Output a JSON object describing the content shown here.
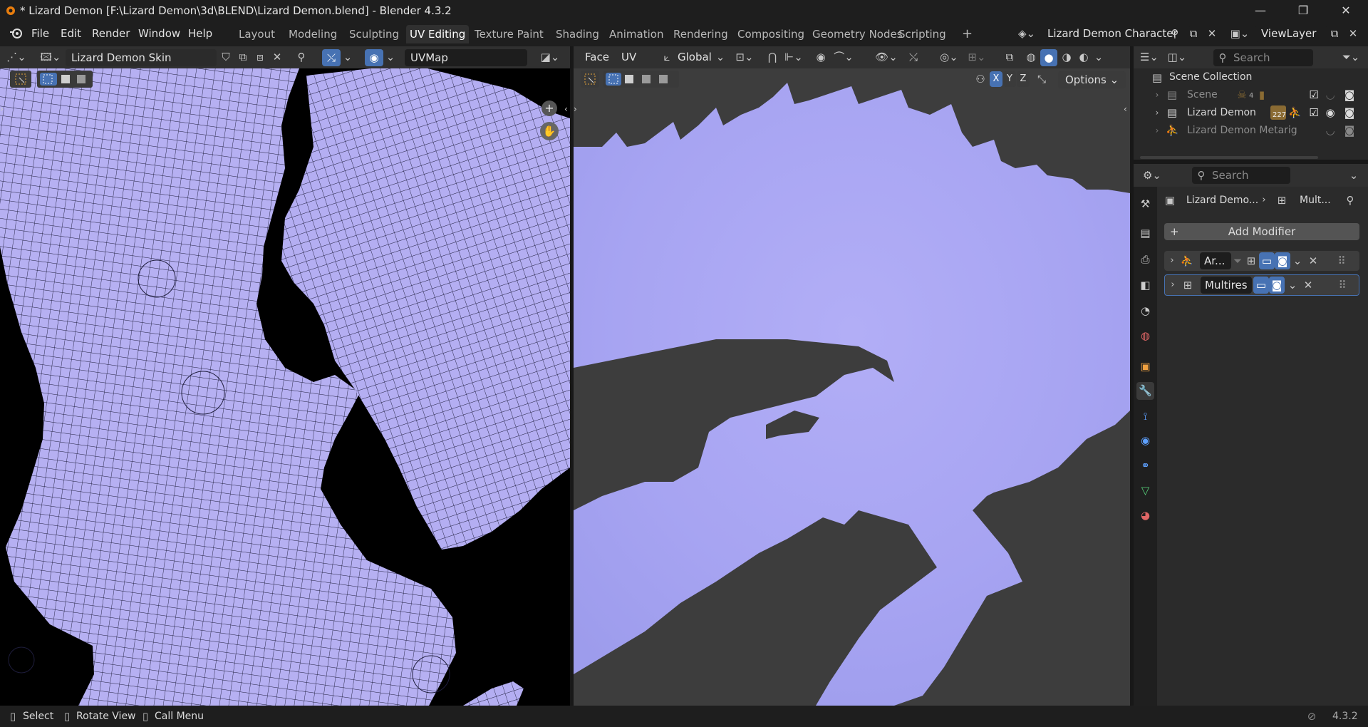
{
  "window": {
    "title": "* Lizard Demon [F:\\Lizard Demon\\3d\\BLEND\\Lizard Demon.blend] - Blender 4.3.2",
    "minimize": "—",
    "maximize": "❐",
    "close": "✕"
  },
  "menu": {
    "file": "File",
    "edit": "Edit",
    "render": "Render",
    "window": "Window",
    "help": "Help"
  },
  "workspaces": [
    "Layout",
    "Modeling",
    "Sculpting",
    "UV Editing",
    "Texture Paint",
    "Shading",
    "Animation",
    "Rendering",
    "Compositing",
    "Geometry Nodes",
    "Scripting"
  ],
  "active_workspace": "UV Editing",
  "add_workspace": "+",
  "scene_name": "Lizard Demon Character",
  "view_layer": "ViewLayer",
  "uv_editor": {
    "image_name": "Lizard Demon Skin Normal.jpg",
    "uv_map": "UVMap"
  },
  "viewport": {
    "menu_face": "Face",
    "menu_uv": "UV",
    "transform_orientation": "Global",
    "axis_x": "X",
    "axis_y": "Y",
    "axis_z": "Z",
    "options": "Options"
  },
  "outliner": {
    "search_placeholder": "Search",
    "root": "Scene Collection",
    "items": [
      {
        "label": "Scene",
        "badge": "4"
      },
      {
        "label": "Lizard Demon",
        "badge": "227"
      },
      {
        "label": "Lizard Demon Metarig",
        "badge": ""
      }
    ]
  },
  "properties": {
    "search_placeholder": "Search",
    "breadcrumb_object": "Lizard Demo...",
    "breadcrumb_modifier": "Mult...",
    "add_modifier": "Add Modifier",
    "modifiers": [
      {
        "name": "Ar..."
      },
      {
        "name": "Multires"
      }
    ]
  },
  "status": {
    "select": "Select",
    "rotate_view": "Rotate View",
    "call_menu": "Call Menu",
    "version": "4.3.2"
  },
  "colors": {
    "accent": "#4772b3",
    "active_tab": "#303030",
    "uv_fill": "#b9b2f5",
    "viewport_bg": "#3d3d3d"
  }
}
